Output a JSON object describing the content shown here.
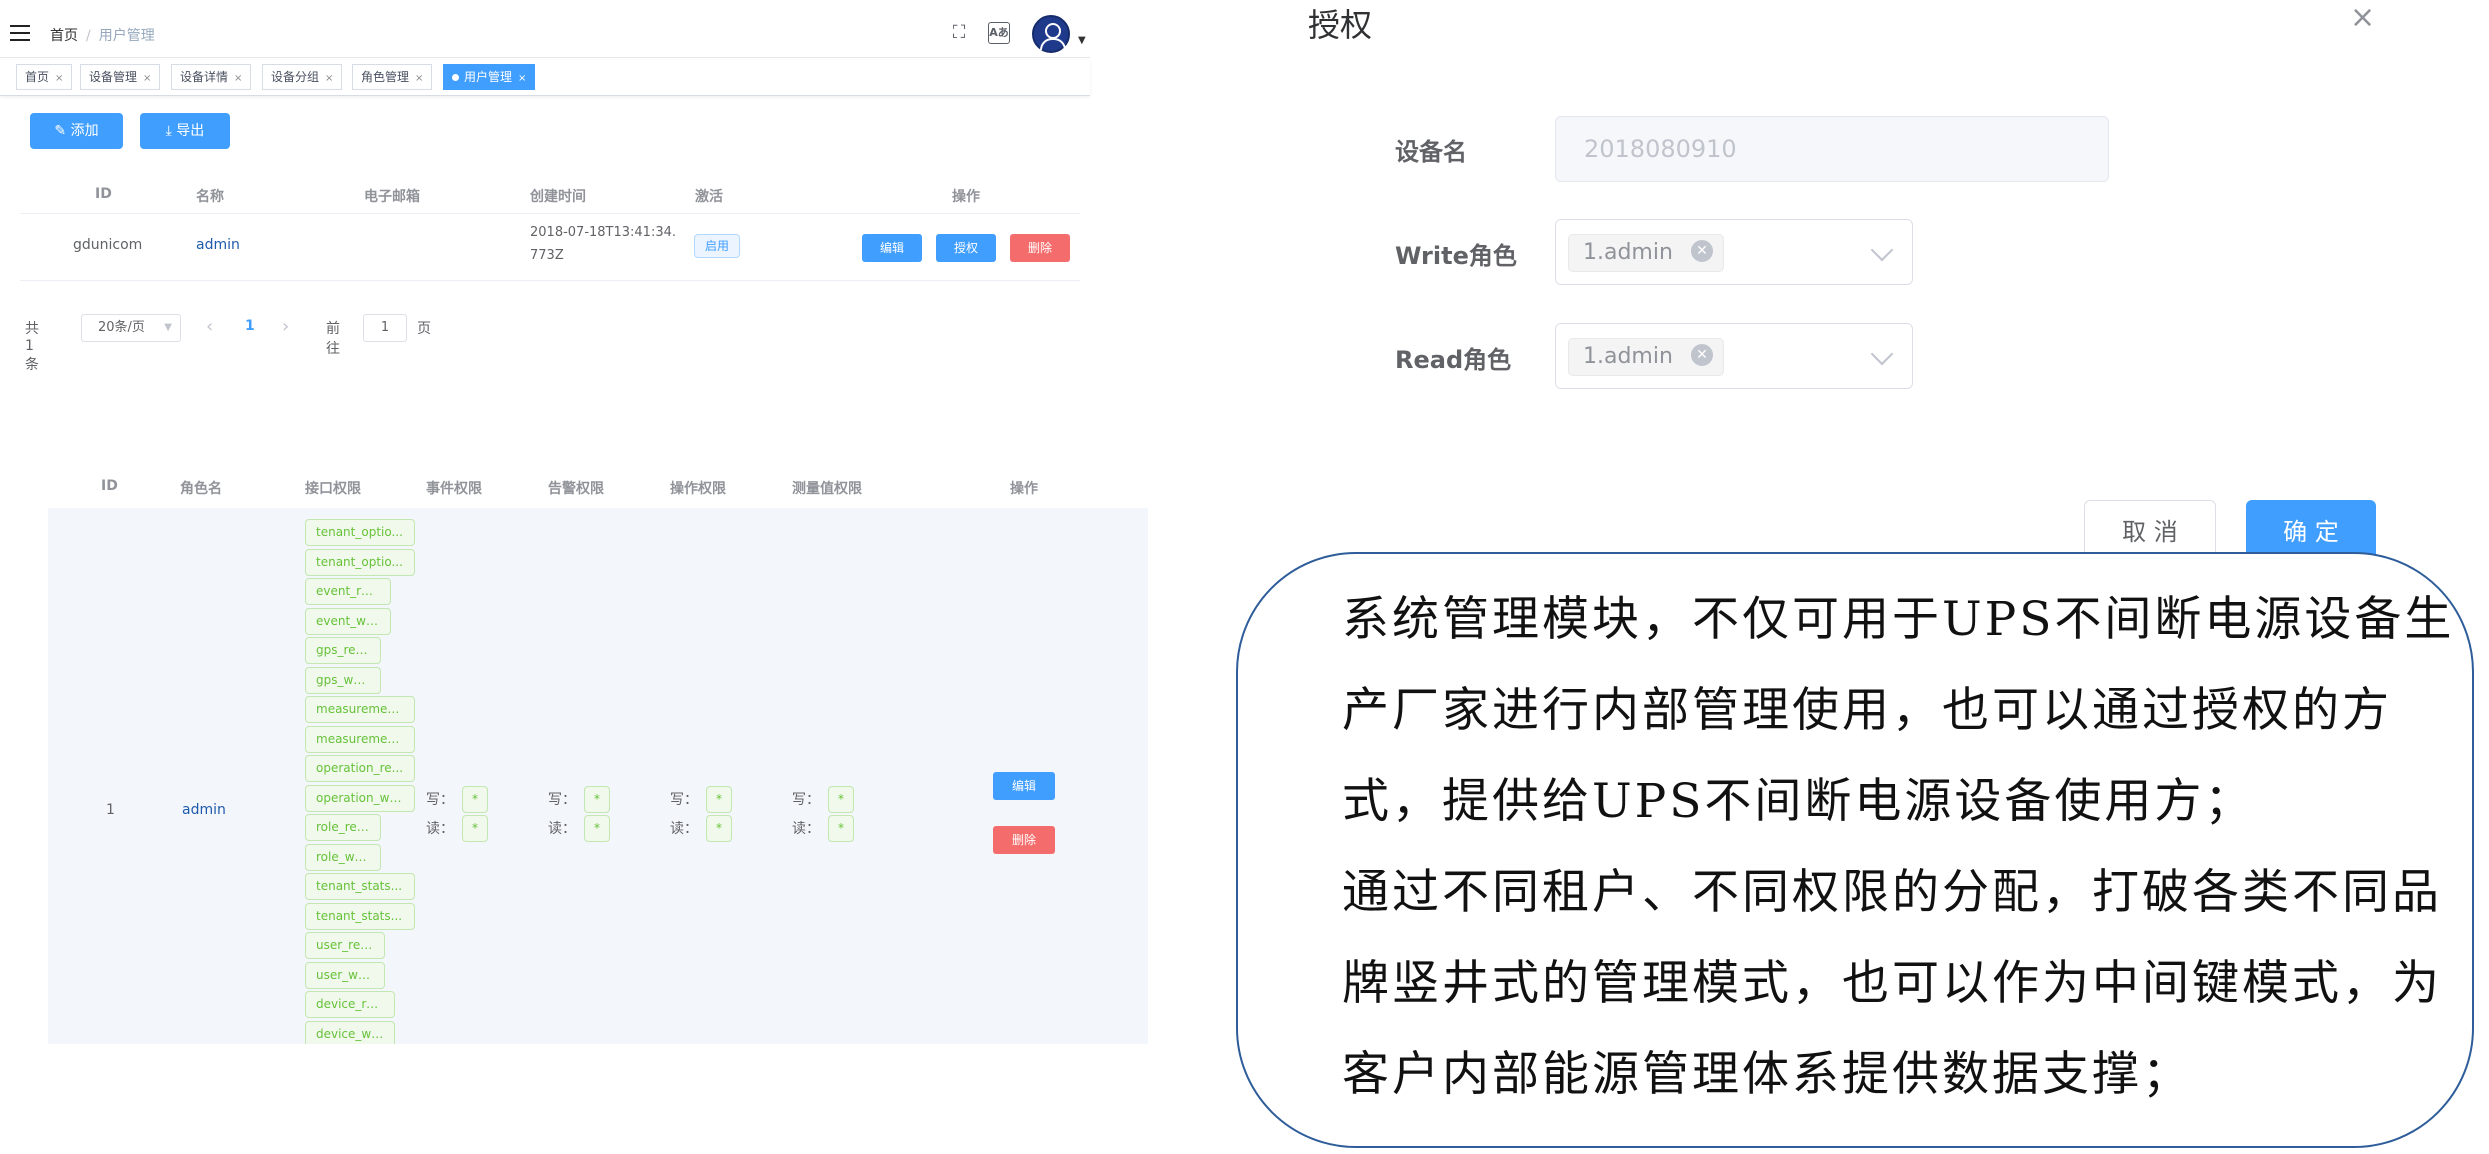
{
  "admin": {
    "breadcrumb": {
      "home": "首页",
      "separator": "/",
      "current": "用户管理"
    },
    "toolbar_icons": [
      "fullscreen-icon",
      "translate-icon"
    ],
    "tags": [
      {
        "label": "首页",
        "active": false
      },
      {
        "label": "设备管理",
        "active": false
      },
      {
        "label": "设备详情",
        "active": false
      },
      {
        "label": "设备分组",
        "active": false
      },
      {
        "label": "角色管理",
        "active": false
      },
      {
        "label": "用户管理",
        "active": true
      }
    ],
    "tag_close": "×",
    "buttons": {
      "add": "✎ 添加",
      "export": "⤓ 导出"
    },
    "user_table": {
      "headers": [
        "ID",
        "名称",
        "电子邮箱",
        "创建时间",
        "激活",
        "操作"
      ],
      "row": {
        "id": "gdunicom",
        "name": "admin",
        "email": "",
        "created_line1": "2018-07-18T13:41:34.",
        "created_line2": "773Z",
        "active": "启用",
        "actions": {
          "edit": "编辑",
          "authorize": "授权",
          "delete": "删除"
        }
      }
    },
    "pagination": {
      "total": "共 1 条",
      "page_size": "20条/页",
      "prev": "‹",
      "current_page": "1",
      "next": "›",
      "goto_prefix": "前往",
      "goto_value": "1",
      "goto_suffix": "页"
    }
  },
  "role_table": {
    "headers": [
      "ID",
      "角色名",
      "接口权限",
      "事件权限",
      "告警权限",
      "操作权限",
      "测量值权限",
      "操作"
    ],
    "row": {
      "id": "1",
      "name": "admin",
      "api_permissions": [
        "tenant_optio...",
        "tenant_optio...",
        "event_read",
        "event_write",
        "gps_read",
        "gps_write",
        "measuremen...",
        "measuremen...",
        "operation_re...",
        "operation_wr...",
        "role_read",
        "role_write",
        "tenant_stats...",
        "tenant_stats...",
        "user_read",
        "user_write",
        "device_read",
        "device_write"
      ],
      "write_label": "写：",
      "read_label": "读：",
      "wildcard": "*",
      "actions": {
        "edit": "编辑",
        "delete": "删除"
      }
    }
  },
  "dialog": {
    "title": "授权",
    "close": "×",
    "fields": {
      "device_label": "设备名",
      "device_value": "2018080910",
      "write_label": "Write角色",
      "write_value": "1.admin",
      "read_label": "Read角色",
      "read_value": "1.admin"
    },
    "cancel": "取 消",
    "confirm": "确 定"
  },
  "callout": {
    "paragraph1": "系统管理模块，不仅可用于UPS不间断电源设备生产厂家进行内部管理使用，也可以通过授权的方式，提供给UPS不间断电源设备使用方；",
    "paragraph2": "通过不同租户、不同权限的分配，打破各类不同品牌竖井式的管理模式，也可以作为中间键模式，为客户内部能源管理体系提供数据支撑；"
  }
}
